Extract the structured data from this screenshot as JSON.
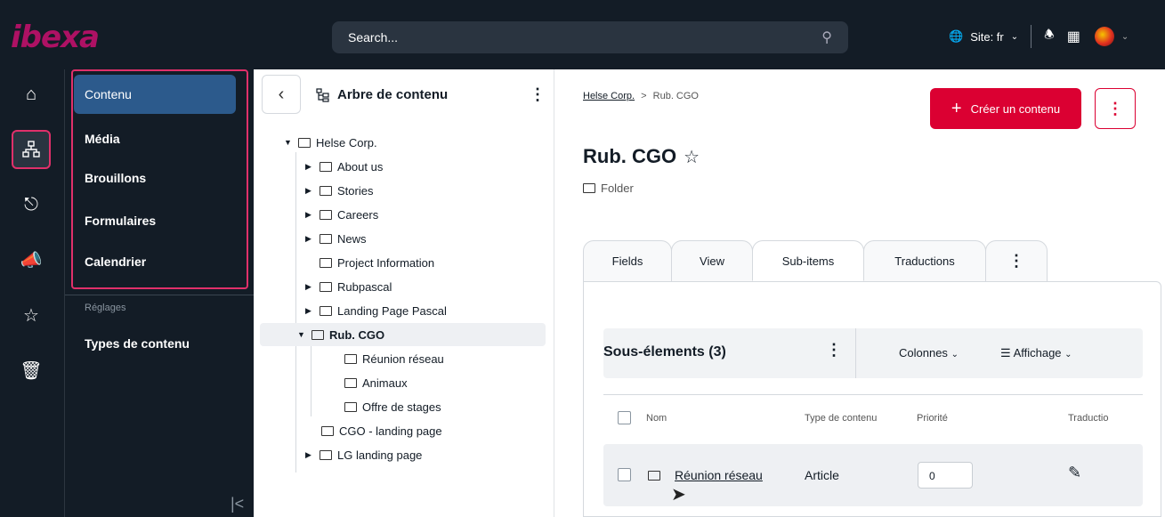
{
  "topbar": {
    "logo": "ibexa",
    "search_placeholder": "Search...",
    "site_label": "Site: fr"
  },
  "sidebar": {
    "items": [
      {
        "label": "Contenu"
      },
      {
        "label": "Média"
      },
      {
        "label": "Brouillons"
      },
      {
        "label": "Formulaires"
      },
      {
        "label": "Calendrier"
      }
    ],
    "section_label": "Réglages",
    "settings_item": "Types de contenu"
  },
  "tree": {
    "title": "Arbre de contenu",
    "root": "Helse Corp.",
    "children": [
      "About us",
      "Stories",
      "Careers",
      "News",
      "Project Information",
      "Rubpascal",
      "Landing Page Pascal",
      "Rub. CGO"
    ],
    "selected_children": [
      "Réunion réseau",
      "Animaux",
      "Offre de stages"
    ],
    "after": [
      "CGO - landing page",
      "LG landing page"
    ]
  },
  "content": {
    "breadcrumb_root": "Helse Corp.",
    "breadcrumb_sep": ">",
    "breadcrumb_current": "Rub. CGO",
    "create_label": "Créer un contenu",
    "title": "Rub. CGO",
    "content_type": "Folder",
    "tabs": [
      "Fields",
      "View",
      "Sub-items",
      "Traductions"
    ],
    "active_tab": "Sub-items",
    "subitems_title": "Sous-élements (3)",
    "columns_label": "Colonnes",
    "display_label": "Affichage",
    "table_headers": [
      "Nom",
      "Type de contenu",
      "Priorité",
      "Traductio"
    ],
    "row": {
      "name": "Réunion réseau",
      "type": "Article",
      "priority": "0"
    }
  },
  "colors": {
    "brand": "#ae1164",
    "accent": "#db0032",
    "nav_bg": "#131c26",
    "active_item": "#2c5a8c"
  }
}
